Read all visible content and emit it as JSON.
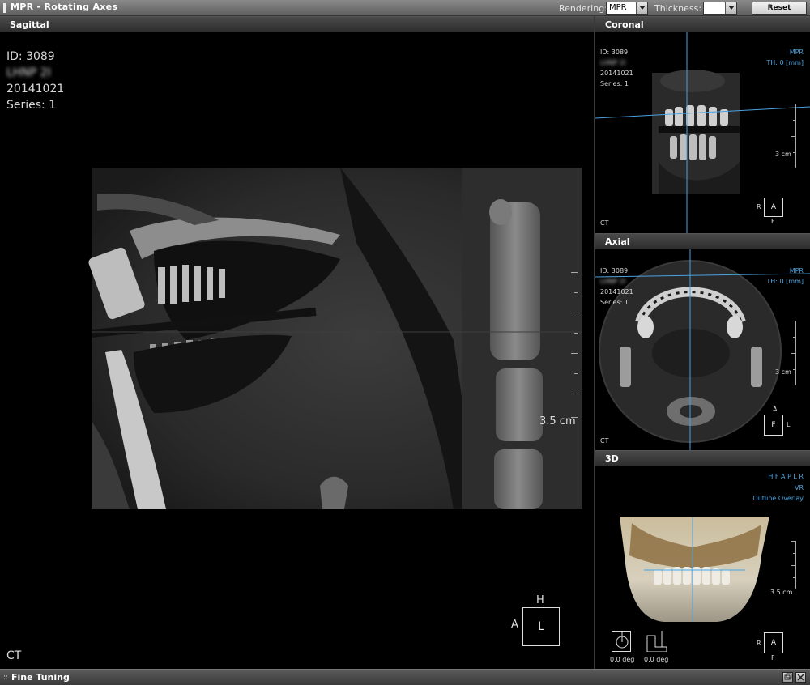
{
  "window": {
    "title": "MPR - Rotating Axes",
    "rendering_label": "Rendering:",
    "rendering_value": "MPR",
    "thickness_label": "Thickness:",
    "thickness_value": "",
    "reset_label": "Reset"
  },
  "panels": {
    "sagittal": {
      "title": "Sagittal",
      "id": "ID: 3089",
      "name": "LHNP 2I",
      "date": "20141021",
      "series": "Series: 1",
      "modality": "CT",
      "scale": "3.5 cm",
      "orient_center": "L",
      "orient_top": "H",
      "orient_left": "A"
    },
    "coronal": {
      "title": "Coronal",
      "id": "ID: 3089",
      "name": "LHNP 2I",
      "date": "20141021",
      "series": "Series: 1",
      "mode": "MPR",
      "thickness": "TH: 0 [mm]",
      "modality": "CT",
      "scale": "3 cm",
      "orient_center": "A",
      "orient_left": "R",
      "orient_bottom": "F"
    },
    "axial": {
      "title": "Axial",
      "id": "ID: 3089",
      "name": "LHNP 2I",
      "date": "20141021",
      "series": "Series: 1",
      "mode": "MPR",
      "thickness": "TH: 0 [mm]",
      "modality": "CT",
      "scale": "3 cm",
      "orient_center": "F",
      "orient_right": "L",
      "orient_top": "A"
    },
    "three_d": {
      "title": "3D",
      "directions": "H F A P L R",
      "mode": "VR",
      "overlay": "Outline Overlay",
      "scale": "3.5 cm",
      "orient_center": "A",
      "orient_left": "R",
      "orient_bottom": "F",
      "angle1": "0.0 deg",
      "angle2": "0.0 deg"
    }
  },
  "bottom": {
    "title": "Fine Tuning"
  },
  "colors": {
    "crosshair": "#4aa3e0",
    "accent_text": "#4aa3e0"
  }
}
